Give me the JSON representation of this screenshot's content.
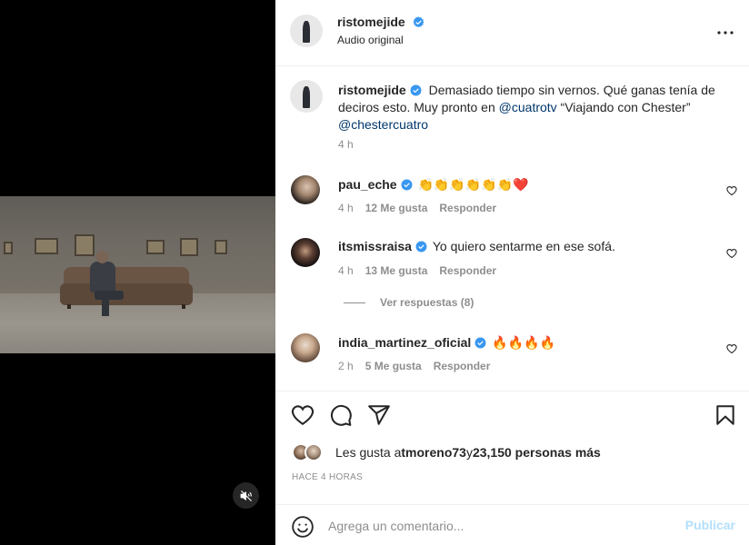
{
  "post": {
    "author": "ristomejide",
    "audio": "Audio original"
  },
  "caption": {
    "username": "ristomejide",
    "text_start": "Demasiado tiempo sin vernos. Qué ganas tenía de deciros esto. Muy pronto en ",
    "mention1": "@cuatrotv",
    "text_mid": " “Viajando con Chester” ",
    "mention2": "@chestercuatro",
    "time": "4 h"
  },
  "comments": [
    {
      "username": "pau_eche",
      "text": "👏👏👏👏👏👏❤️",
      "time": "4 h",
      "likes": "12 Me gusta",
      "reply": "Responder"
    },
    {
      "username": "itsmissraisa",
      "text": "Yo quiero sentarme en ese sofá.",
      "time": "4 h",
      "likes": "13 Me gusta",
      "reply": "Responder"
    },
    {
      "username": "india_martinez_oficial",
      "text": "🔥🔥🔥🔥",
      "time": "2 h",
      "likes": "5 Me gusta",
      "reply": "Responder"
    }
  ],
  "view_replies": "Ver respuestas (8)",
  "likes": {
    "prefix": "Les gusta a ",
    "user": "tmoreno73",
    "joiner": " y ",
    "others": "23,150 personas más"
  },
  "posted_ago": "HACE 4 HORAS",
  "comment_box": {
    "placeholder": "Agrega un comentario...",
    "post_label": "Publicar"
  },
  "icons": [
    "mute-icon",
    "more-options-icon",
    "verified-badge-icon",
    "heart-icon",
    "comment-icon",
    "share-icon",
    "bookmark-icon",
    "emoji-icon"
  ],
  "colors": {
    "verified": "#3897f0",
    "mention": "#00376b",
    "muted_text": "#8e8e8e",
    "post_button_disabled": "#b2dffc"
  }
}
